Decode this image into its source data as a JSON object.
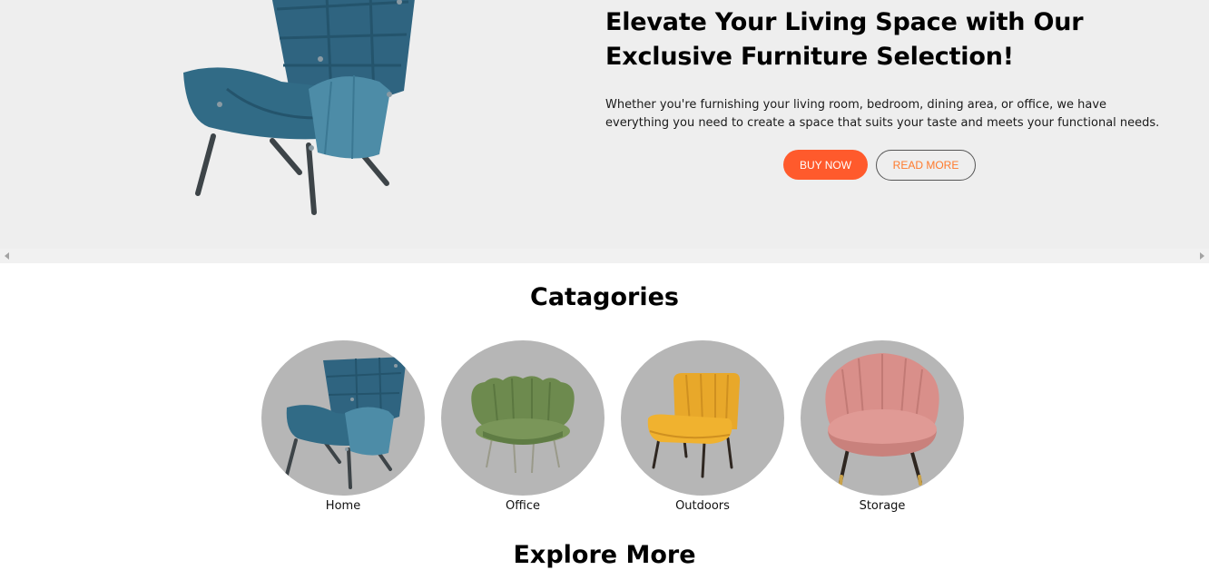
{
  "hero": {
    "title": "Elevate Your Living Space with Our Exclusive Furniture Selection!",
    "description": "Whether you're furnishing your living room, bedroom, dining area, or office, we have everything you need to create a space that suits your taste and meets your functional needs.",
    "buy_label": "BUY NOW",
    "read_label": "READ MORE",
    "image": "teal-armchair-image"
  },
  "categories": {
    "title": "Catagories",
    "items": [
      {
        "label": "Home",
        "image": "teal-armchair-image"
      },
      {
        "label": "Office",
        "image": "green-scalloped-chair-image"
      },
      {
        "label": "Outdoors",
        "image": "yellow-accent-chair-image"
      },
      {
        "label": "Storage",
        "image": "pink-shell-chair-image"
      }
    ]
  },
  "explore": {
    "title": "Explore More"
  },
  "colors": {
    "hero_bg": "#eeeeee",
    "accent": "#ff5a2c",
    "read_text": "#ff7a2c",
    "circle_bg": "#b6b6b6"
  }
}
